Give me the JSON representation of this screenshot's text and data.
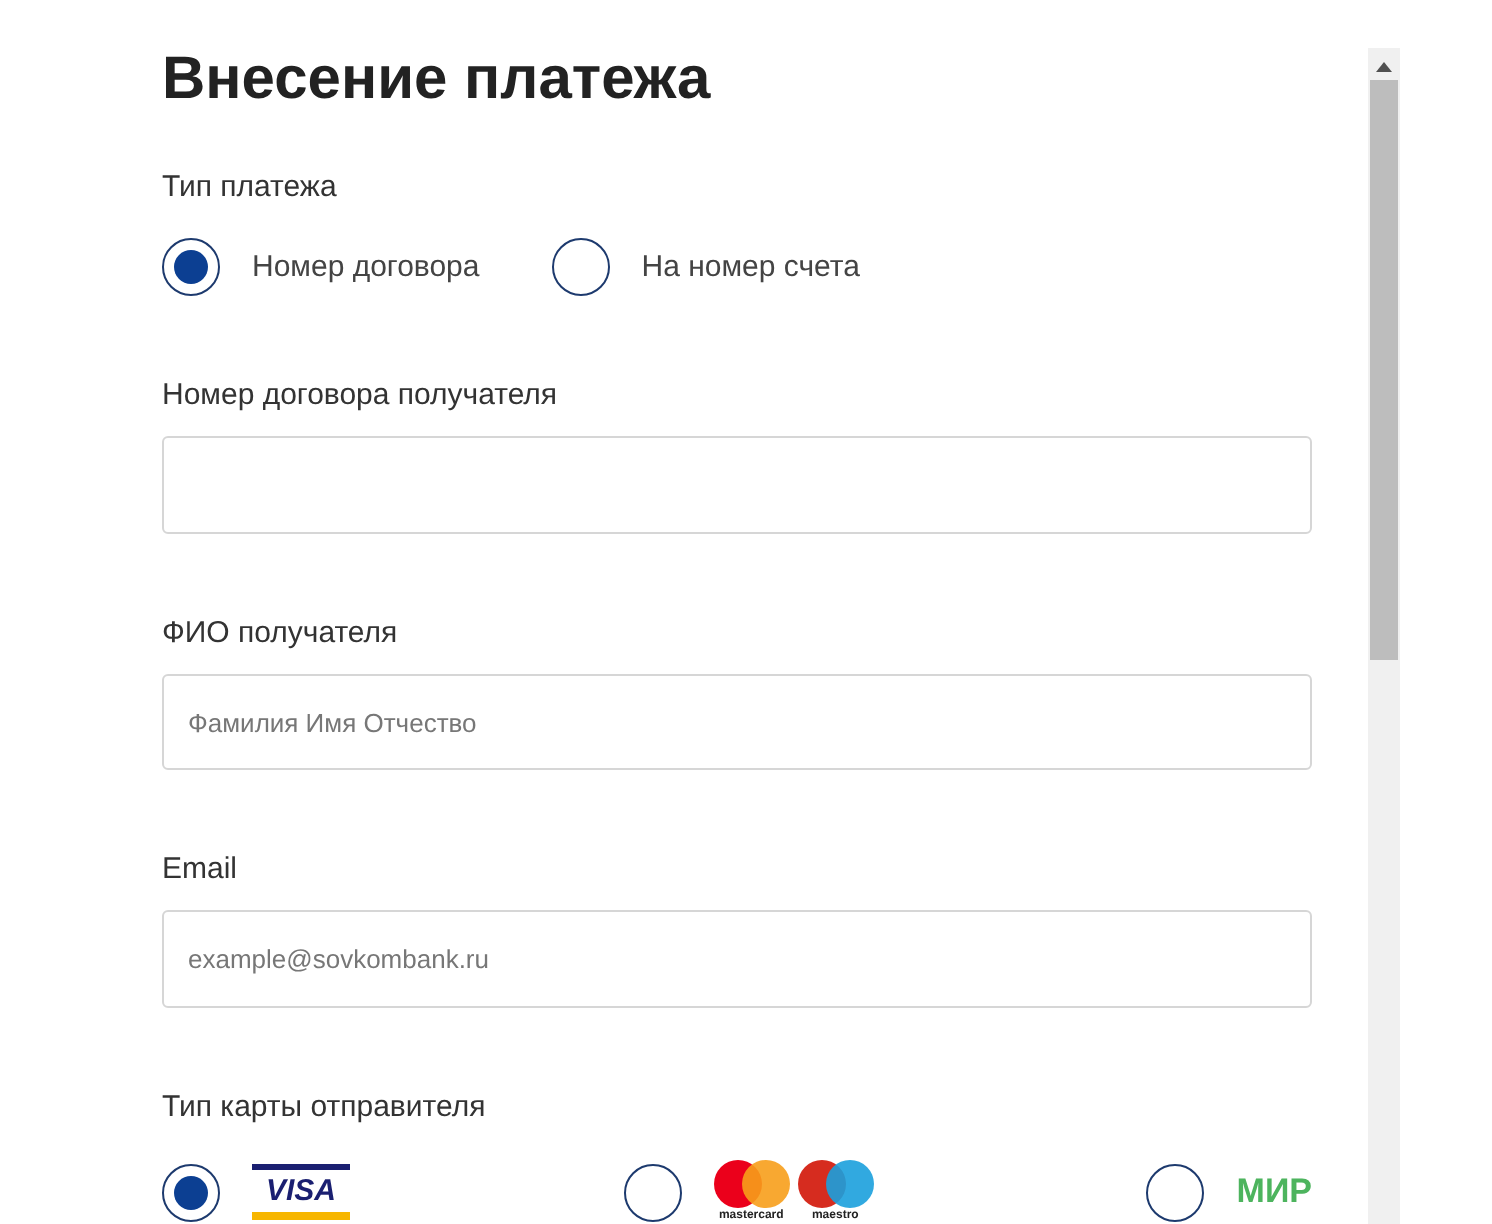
{
  "title": "Внесение платежа",
  "payment_type": {
    "label": "Тип платежа",
    "options": [
      {
        "label": "Номер договора",
        "selected": true
      },
      {
        "label": "На номер счета",
        "selected": false
      }
    ]
  },
  "fields": [
    {
      "label": "Номер договора получателя"
    },
    {
      "label": "ФИО получателя",
      "placeholder": "Фамилия Имя Отчество"
    },
    {
      "label": "Email",
      "placeholder": "example@sovkombank.ru"
    }
  ],
  "card_type": {
    "label": "Тип карты отправителя",
    "options": [
      {
        "kind": "visa",
        "selected": true,
        "logo_texts": [
          "VISA"
        ]
      },
      {
        "kind": "mastercard_maestro",
        "selected": false,
        "logo_texts": [
          "mastercard",
          "maestro"
        ]
      },
      {
        "kind": "mir",
        "selected": false,
        "logo_texts": [
          "МИР"
        ]
      }
    ]
  }
}
